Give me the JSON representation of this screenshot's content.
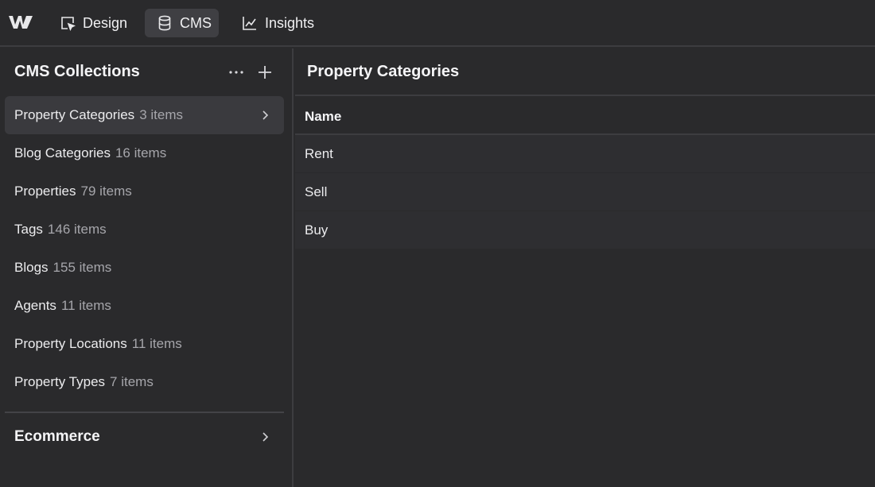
{
  "nav": {
    "design": "Design",
    "cms": "CMS",
    "insights": "Insights"
  },
  "sidebar": {
    "title": "CMS Collections",
    "collections": [
      {
        "name": "Property Categories",
        "count": "3 items"
      },
      {
        "name": "Blog Categories",
        "count": "16 items"
      },
      {
        "name": "Properties",
        "count": "79 items"
      },
      {
        "name": "Tags",
        "count": "146 items"
      },
      {
        "name": "Blogs",
        "count": "155 items"
      },
      {
        "name": "Agents",
        "count": "11 items"
      },
      {
        "name": "Property Locations",
        "count": "11 items"
      },
      {
        "name": "Property Types",
        "count": "7 items"
      }
    ],
    "ecommerce": "Ecommerce"
  },
  "main": {
    "title": "Property Categories",
    "column": "Name",
    "rows": [
      "Rent",
      "Sell",
      "Buy"
    ]
  },
  "colors": {
    "background": "#2a2a2c",
    "active_item": "#3a3a3e",
    "active_nav": "#3f3f43",
    "muted_text": "#a6a6ab"
  }
}
